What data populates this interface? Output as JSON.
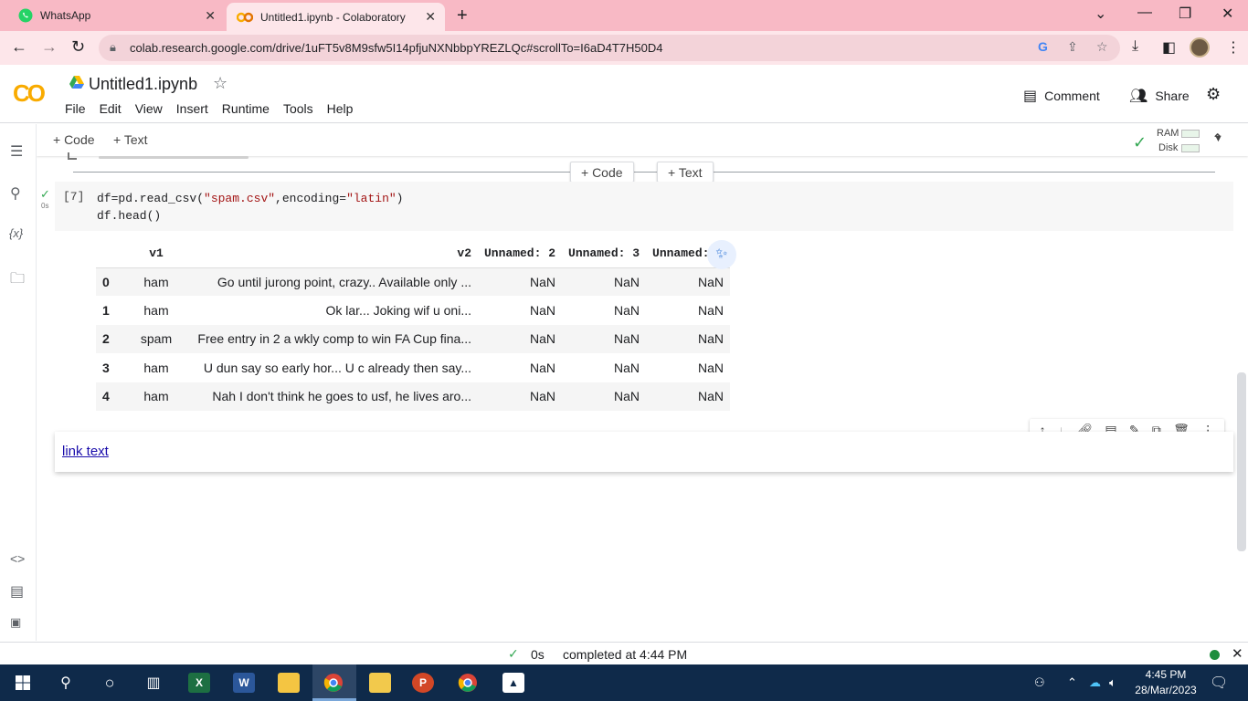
{
  "browser": {
    "tabs": [
      {
        "title": "WhatsApp",
        "icon": "whatsapp-icon",
        "active": false
      },
      {
        "title": "Untitled1.ipynb - Colaboratory",
        "icon": "colab-icon",
        "active": true
      }
    ],
    "url": "colab.research.google.com/drive/1uFT5v8M9sfw5I14pfjuNXNbbpYREZLQc#scrollTo=I6aD4T7H50D4"
  },
  "colab": {
    "logo": "CO",
    "notebook_title": "Untitled1.ipynb",
    "menu": [
      "File",
      "Edit",
      "View",
      "Insert",
      "Runtime",
      "Tools",
      "Help"
    ],
    "comment_label": "Comment",
    "share_label": "Share"
  },
  "toolbar": {
    "add_code": "+ Code",
    "add_text": "+ Text",
    "ram_label": "RAM",
    "disk_label": "Disk"
  },
  "cell": {
    "execution_count": "[7]",
    "exec_time": "0s",
    "code_lines": [
      {
        "pre": "df=pd.read_csv(",
        "s1": "\"spam.csv\"",
        "mid": ",encoding=",
        "s2": "\"latin\"",
        "post": ")"
      },
      {
        "pre": "df.head()",
        "s1": "",
        "mid": "",
        "s2": "",
        "post": ""
      }
    ]
  },
  "dataframe": {
    "columns": [
      "",
      "v1",
      "v2",
      "Unnamed: 2",
      "Unnamed: 3",
      "Unnamed: 4"
    ],
    "rows": [
      [
        "0",
        "ham",
        "Go until jurong point, crazy.. Available only ...",
        "NaN",
        "NaN",
        "NaN"
      ],
      [
        "1",
        "ham",
        "Ok lar... Joking wif u oni...",
        "NaN",
        "NaN",
        "NaN"
      ],
      [
        "2",
        "spam",
        "Free entry in 2 a wkly comp to win FA Cup fina...",
        "NaN",
        "NaN",
        "NaN"
      ],
      [
        "3",
        "ham",
        "U dun say so early hor... U c already then say...",
        "NaN",
        "NaN",
        "NaN"
      ],
      [
        "4",
        "ham",
        "Nah I don't think he goes to usf, he lives aro...",
        "NaN",
        "NaN",
        "NaN"
      ]
    ]
  },
  "text_cell": {
    "link_text": "link text"
  },
  "status": {
    "exec_time": "0s",
    "message": "completed at 4:44 PM"
  },
  "taskbar": {
    "time": "4:45 PM",
    "date": "28/Mar/2023"
  },
  "colors": {
    "tab_strip": "#f8b9c5",
    "active_tab": "#fde6ea",
    "colab_orange": "#f9ab00",
    "success_green": "#34a853",
    "taskbar": "#0f2a4a"
  }
}
